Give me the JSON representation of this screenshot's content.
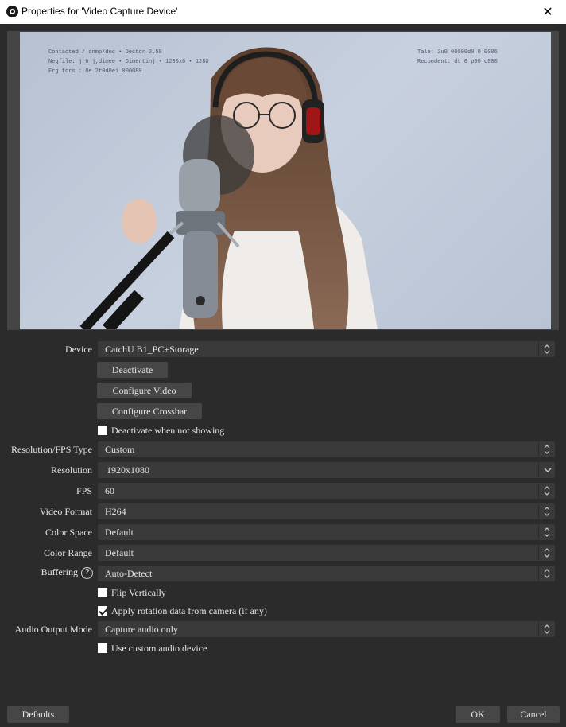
{
  "window": {
    "title": "Properties for 'Video Capture Device'",
    "app_icon": "obs-logo-icon",
    "close_glyph": "✕"
  },
  "preview": {
    "overlay_left": [
      "Contacted / dnmp/dnc • Dector 2.58",
      "Negfile: j,6 j,dimee • Dimentinj • 1280x6 • 1280",
      "Frg fdrs : 0e 2f0d0ei 000080"
    ],
    "overlay_right": [
      "Tale: 2u0 00000d0 0 0006",
      "Recondent: dt 0 p00 d000"
    ]
  },
  "form": {
    "device": {
      "label": "Device",
      "value": "CatchU B1_PC+Storage"
    },
    "deactivate_label": "Deactivate",
    "configure_video_label": "Configure Video",
    "configure_crossbar_label": "Configure Crossbar",
    "deactivate_when_not_showing": {
      "label": "Deactivate when not showing",
      "checked": false
    },
    "res_fps_type": {
      "label": "Resolution/FPS Type",
      "value": "Custom"
    },
    "resolution": {
      "label": "Resolution",
      "value": "1920x1080"
    },
    "fps": {
      "label": "FPS",
      "value": "60"
    },
    "video_format": {
      "label": "Video Format",
      "value": "H264"
    },
    "color_space": {
      "label": "Color Space",
      "value": "Default"
    },
    "color_range": {
      "label": "Color Range",
      "value": "Default"
    },
    "buffering": {
      "label": "Buffering",
      "value": "Auto-Detect",
      "help_glyph": "?"
    },
    "flip_vertically": {
      "label": "Flip Vertically",
      "checked": false
    },
    "apply_rotation": {
      "label": "Apply rotation data from camera (if any)",
      "checked": true
    },
    "audio_output_mode": {
      "label": "Audio Output Mode",
      "value": "Capture audio only"
    },
    "use_custom_audio": {
      "label": "Use custom audio device",
      "checked": false
    }
  },
  "footer": {
    "defaults_label": "Defaults",
    "ok_label": "OK",
    "cancel_label": "Cancel"
  },
  "colors": {
    "background": "#2b2b2b",
    "control": "#3a3a3a",
    "button": "#464646",
    "text": "#e6e6e6"
  }
}
